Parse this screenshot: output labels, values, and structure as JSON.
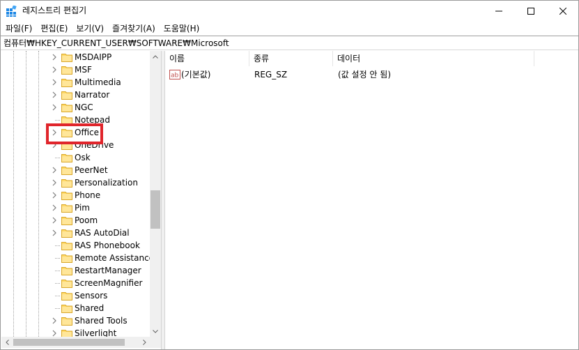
{
  "window": {
    "title": "레지스트리 편집기",
    "icon": "registry-editor-icon",
    "controls": [
      "minimize-icon",
      "maximize-icon",
      "close-icon"
    ]
  },
  "menu": {
    "items": [
      "파일(F)",
      "편집(E)",
      "보기(V)",
      "즐겨찾기(A)",
      "도움말(H)"
    ]
  },
  "address": {
    "path": "컴퓨터₩HKEY_CURRENT_USER₩SOFTWARE₩Microsoft"
  },
  "tree": {
    "items": [
      {
        "label": "MSDAIPP",
        "expandable": true
      },
      {
        "label": "MSF",
        "expandable": true
      },
      {
        "label": "Multimedia",
        "expandable": true
      },
      {
        "label": "Narrator",
        "expandable": true
      },
      {
        "label": "NGC",
        "expandable": true
      },
      {
        "label": "Notepad",
        "expandable": false
      },
      {
        "label": "Office",
        "expandable": true,
        "highlighted": true
      },
      {
        "label": "OneDrive",
        "expandable": true
      },
      {
        "label": "Osk",
        "expandable": false
      },
      {
        "label": "PeerNet",
        "expandable": true
      },
      {
        "label": "Personalization",
        "expandable": true
      },
      {
        "label": "Phone",
        "expandable": true
      },
      {
        "label": "Pim",
        "expandable": true
      },
      {
        "label": "Poom",
        "expandable": true
      },
      {
        "label": "RAS AutoDial",
        "expandable": true
      },
      {
        "label": "RAS Phonebook",
        "expandable": false
      },
      {
        "label": "Remote Assistance",
        "expandable": false
      },
      {
        "label": "RestartManager",
        "expandable": false
      },
      {
        "label": "ScreenMagnifier",
        "expandable": false
      },
      {
        "label": "Sensors",
        "expandable": false
      },
      {
        "label": "Shared",
        "expandable": false
      },
      {
        "label": "Shared Tools",
        "expandable": true
      },
      {
        "label": "Silverlight",
        "expandable": true
      }
    ],
    "highlight_color": "#e0252b",
    "folder_color": "#ffd966"
  },
  "list": {
    "columns": [
      "이름",
      "종류",
      "데이터"
    ],
    "rows": [
      {
        "icon": "string-value-icon",
        "name": "(기본값)",
        "type": "REG_SZ",
        "data": "(값 설정 안 됨)"
      }
    ]
  }
}
